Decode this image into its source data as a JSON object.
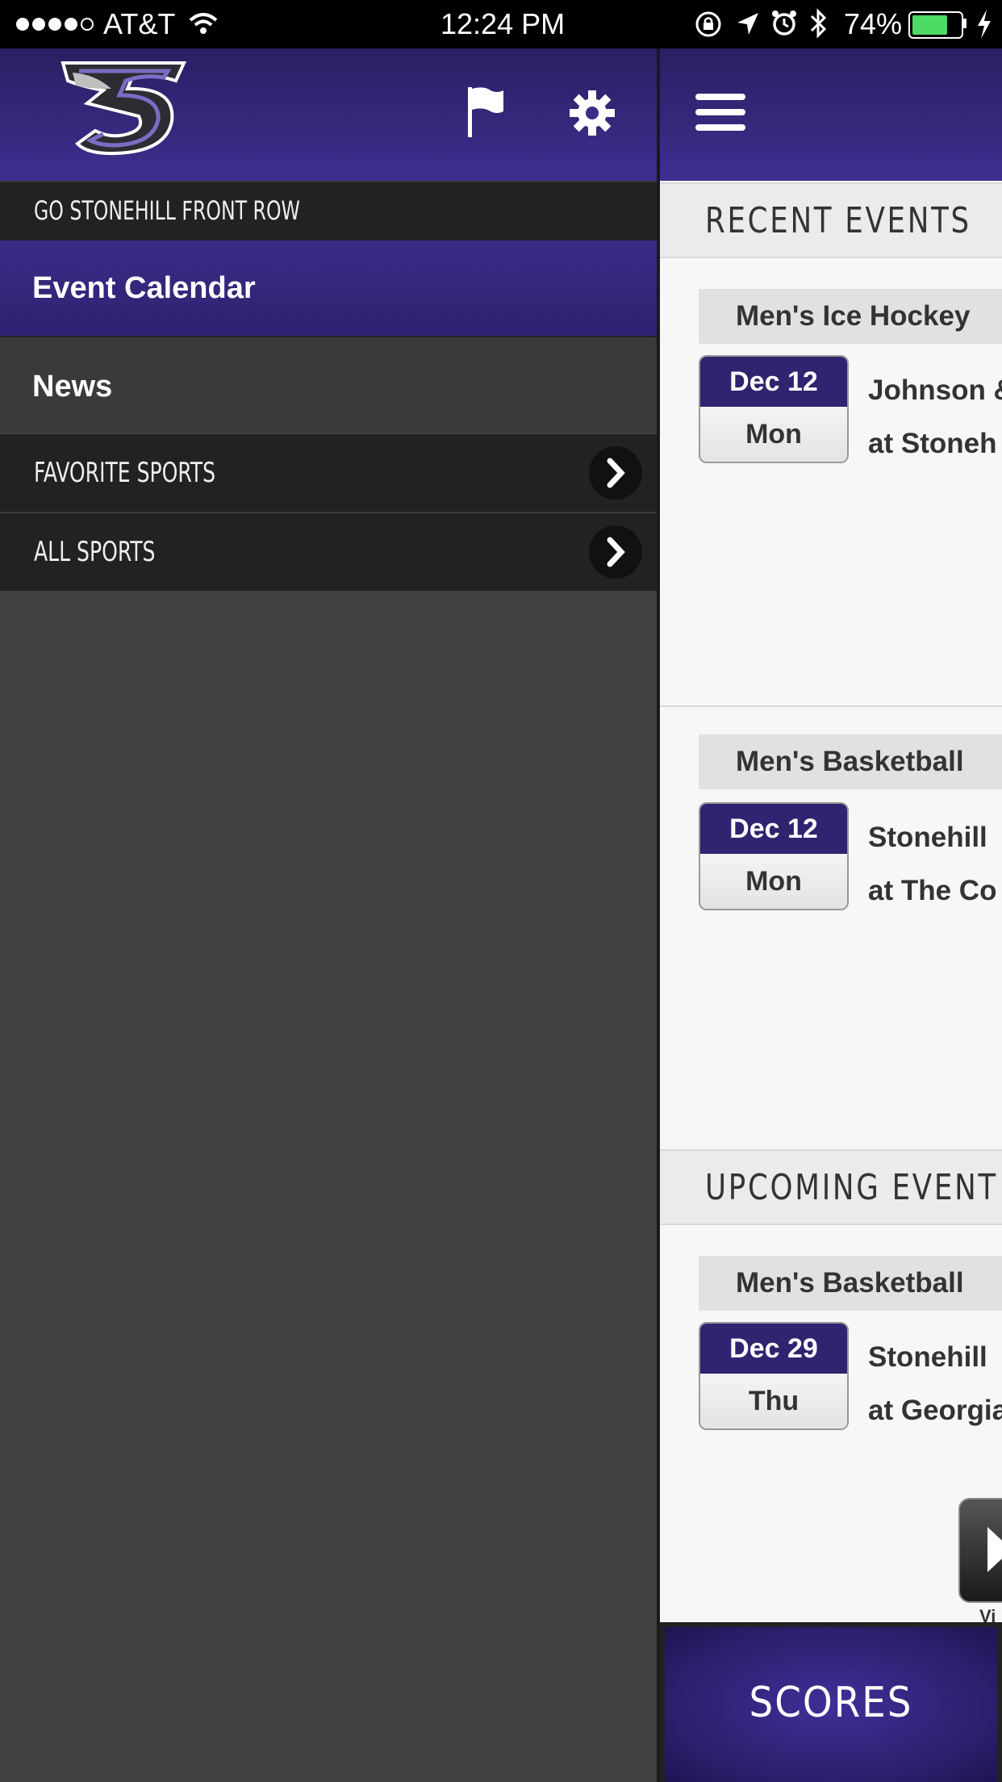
{
  "status_bar": {
    "carrier": "AT&T",
    "time": "12:24 PM",
    "battery": "74%",
    "battery_level": 0.74
  },
  "drawer": {
    "logo_icon": "stonehill-skyhawks-logo",
    "flag_icon": "flag-icon",
    "settings_icon": "gear-icon",
    "top_label": "GO STONEHILL FRONT ROW",
    "items": [
      {
        "label": "Event Calendar",
        "selected": true
      },
      {
        "label": "News",
        "selected": false
      }
    ],
    "sections": [
      {
        "label": "FAVORITE SPORTS"
      },
      {
        "label": "ALL SPORTS"
      }
    ]
  },
  "main": {
    "menu_icon": "hamburger-icon",
    "recent_header": "RECENT EVENTS",
    "upcoming_header": "UPCOMING EVENT",
    "recent_events": [
      {
        "sport": "Men's Ice Hockey",
        "date": "Dec 12",
        "day": "Mon",
        "line1": "Johnson &",
        "line2": "at Stoneh"
      },
      {
        "sport": "Men's Basketball",
        "date": "Dec 12",
        "day": "Mon",
        "line1": "Stonehill",
        "line2": "at The Co"
      }
    ],
    "upcoming_events": [
      {
        "sport": "Men's Basketball",
        "date": "Dec 29",
        "day": "Thu",
        "line1": "Stonehill",
        "line2": "at Georgia"
      }
    ],
    "video_label": "Vi",
    "scores_label": "SCORES"
  },
  "colors": {
    "brand_purple": "#3d2f8f",
    "drawer_bg": "#424242",
    "drawer_bar": "#222222"
  }
}
